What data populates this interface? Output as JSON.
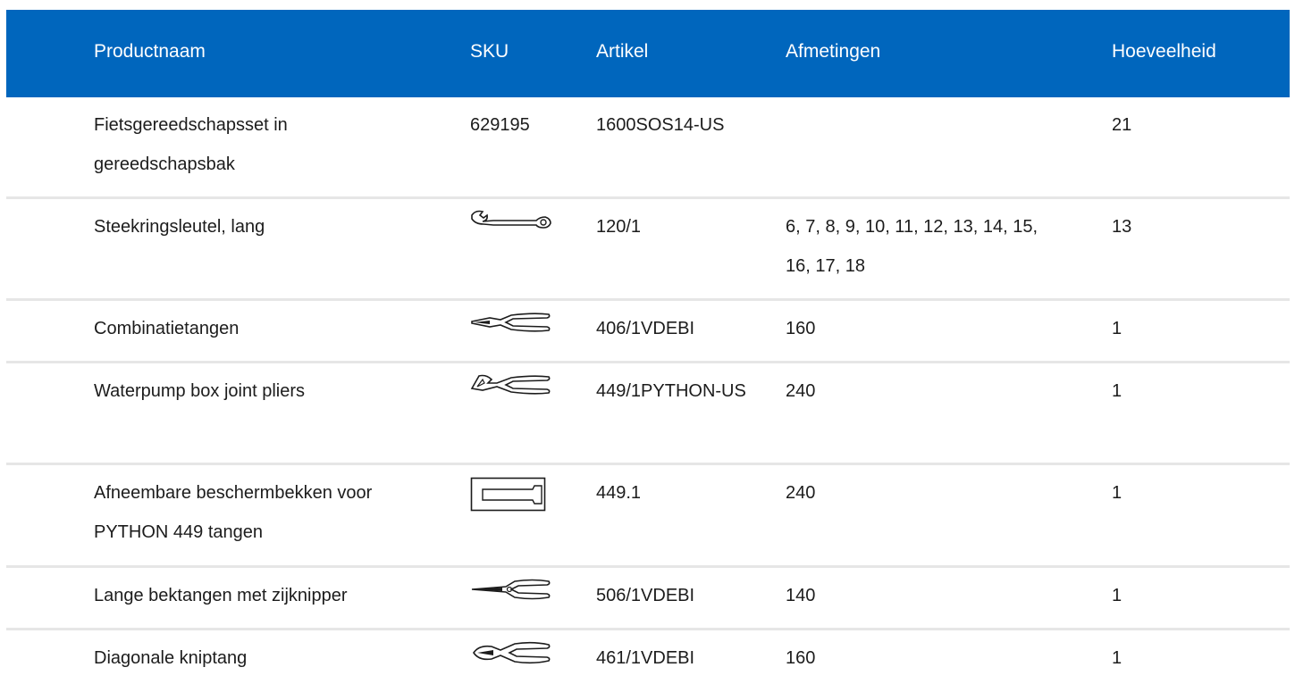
{
  "table": {
    "headers": {
      "name": "Productnaam",
      "sku": "SKU",
      "article": "Artikel",
      "dimensions": "Afmetingen",
      "quantity": "Hoeveelheid"
    },
    "rows": [
      {
        "name": "Fietsgereedschapsset in gereedschapsbak",
        "sku": "629195",
        "article": "1600SOS14-US",
        "dimensions": "",
        "quantity": "21"
      },
      {
        "name": "Steekringsleutel, lang",
        "icon": "wrench-icon",
        "article": "120/1",
        "dimensions": "6, 7, 8, 9, 10, 11, 12, 13, 14, 15, 16, 17, 18",
        "quantity": "13"
      },
      {
        "name": "Combinatietangen",
        "icon": "combination-pliers-icon",
        "article": "406/1VDEBI",
        "dimensions": "160",
        "quantity": "1"
      },
      {
        "name": "Waterpump box joint pliers",
        "icon": "waterpump-pliers-icon",
        "article": "449/1PYTHON-US",
        "dimensions": "240",
        "quantity": "1"
      },
      {
        "name": "Afneembare beschermbekken voor PYTHON 449 tangen",
        "icon": "protective-jaws-icon",
        "article": "449.1",
        "dimensions": "240",
        "quantity": "1"
      },
      {
        "name": "Lange bektangen met zijknipper",
        "icon": "long-nose-pliers-icon",
        "article": "506/1VDEBI",
        "dimensions": "140",
        "quantity": "1"
      },
      {
        "name": "Diagonale kniptang",
        "icon": "diagonal-cutter-icon",
        "article": "461/1VDEBI",
        "dimensions": "160",
        "quantity": "1"
      }
    ]
  },
  "colors": {
    "header_bg": "#0066bd",
    "header_text": "#ffffff",
    "divider": "#e6e6e6"
  }
}
